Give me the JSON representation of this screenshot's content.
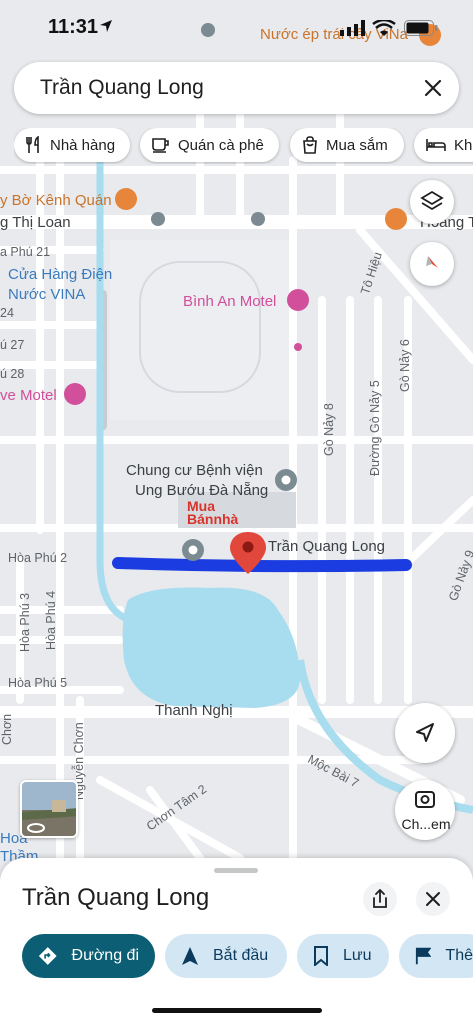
{
  "status_bar": {
    "time": "11:31"
  },
  "search": {
    "value": "Trần Quang Long"
  },
  "chips": [
    {
      "label": "Nhà hàng",
      "icon": "fork-knife-icon"
    },
    {
      "label": "Quán cà phê",
      "icon": "coffee-cup-icon"
    },
    {
      "label": "Mua sắm",
      "icon": "shopping-bag-icon"
    },
    {
      "label": "Khá",
      "icon": "bed-icon"
    }
  ],
  "map": {
    "top_right_label": "Nước ép trái cây ViNa",
    "labels": {
      "bo_kenh_quan": "y Bờ Kênh Quán",
      "thi_loan": "g Thị Loan",
      "hoang_t": "Hoàng T",
      "hoa_phu_21": "a Phú 21",
      "cua_hang": "Cửa Hàng Điện",
      "nuoc_vina": "Nước VINA",
      "n24": "24",
      "n27": "ú 27",
      "n28": "ú 28",
      "ve_motel": "ve Motel",
      "binh_an_motel": "Bình An Motel",
      "to_hieu": "Tô Hiệu",
      "go_nay_6": "Gò Nảy 6",
      "go_nay_5": "Đường Gò Nảy 5",
      "go_nay_8": "Gò Nảy 8",
      "go_nay_9": "Gò Nảy 9",
      "go": "Gò",
      "chung_cu_1": "Chung cư Bệnh viện",
      "chung_cu_2": "Ung Bướu Đà Nẵng",
      "watermark_1": "Mua",
      "watermark_2": "Bán",
      "watermark_3": "nhà",
      "pin_label": "Trần Quang Long",
      "hoa_phu_2": "Hòa Phú 2",
      "hoa_phu_3": "Hòa Phú 3",
      "hoa_phu_4": "Hòa Phú 4",
      "hoa_phu_5": "Hòa Phú 5",
      "thanh_nghi": "Thanh Nghị",
      "nguyen_chon": "Nguyễn Chơn",
      "chon_tam_2": "Chơn Tâm 2",
      "moc_bai_7": "Mộc Bài 7",
      "chon": "Chơn",
      "hoa": "Hoà",
      "tham": "Thầm"
    },
    "chon_em_label": "Ch...em"
  },
  "sheet": {
    "title": "Trần Quang Long",
    "actions": [
      {
        "label": "Đường đi"
      },
      {
        "label": "Bắt đầu"
      },
      {
        "label": "Lưu"
      },
      {
        "label": "Thê"
      }
    ]
  },
  "colors": {
    "route": "#1a3ce0",
    "water": "#a8dcef",
    "pin": "#e2473b",
    "primary_action": "#0b5e73",
    "secondary_action": "#d3e6f3"
  }
}
